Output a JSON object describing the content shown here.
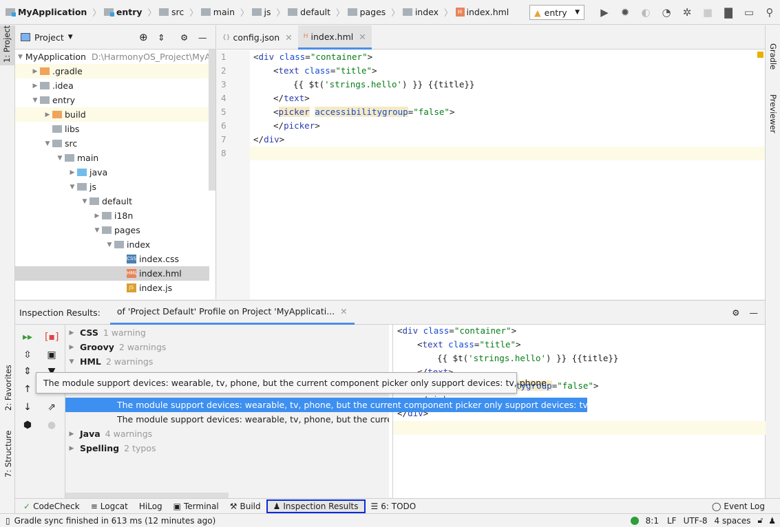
{
  "breadcrumb": [
    "MyApplication",
    "entry",
    "src",
    "main",
    "js",
    "default",
    "pages",
    "index",
    "index.hml"
  ],
  "toolbar": {
    "run_config": "entry",
    "icons": [
      "run-icon",
      "debug-icon",
      "attach-icon",
      "profile-icon",
      "build-icon",
      "stop-icon",
      "project-structure-icon",
      "device-icon",
      "search-icon"
    ]
  },
  "left_stripe": {
    "project": "1: Project",
    "favorites": "2: Favorites",
    "structure": "7: Structure"
  },
  "right_stripe": {
    "gradle": "Gradle",
    "previewer": "Previewer"
  },
  "project_panel": {
    "title": "Project",
    "tree": [
      {
        "label": "MyApplication",
        "path": "D:\\HarmonyOS_Project\\MyA",
        "level": 0,
        "arrow": "down",
        "icon": "module"
      },
      {
        "label": ".gradle",
        "level": 1,
        "arrow": "right",
        "icon": "orange",
        "hl": true
      },
      {
        "label": ".idea",
        "level": 1,
        "arrow": "right",
        "icon": "gray"
      },
      {
        "label": "entry",
        "level": 1,
        "arrow": "down",
        "icon": "module"
      },
      {
        "label": "build",
        "level": 2,
        "arrow": "right",
        "icon": "orange",
        "hl": true
      },
      {
        "label": "libs",
        "level": 2,
        "arrow": "",
        "icon": "gray"
      },
      {
        "label": "src",
        "level": 2,
        "arrow": "down",
        "icon": "gray"
      },
      {
        "label": "main",
        "level": 3,
        "arrow": "down",
        "icon": "gray"
      },
      {
        "label": "java",
        "level": 4,
        "arrow": "right",
        "icon": "blue"
      },
      {
        "label": "js",
        "level": 4,
        "arrow": "down",
        "icon": "gray"
      },
      {
        "label": "default",
        "level": 5,
        "arrow": "down",
        "icon": "gray"
      },
      {
        "label": "i18n",
        "level": 6,
        "arrow": "right",
        "icon": "gray"
      },
      {
        "label": "pages",
        "level": 6,
        "arrow": "down",
        "icon": "gray"
      },
      {
        "label": "index",
        "level": 7,
        "arrow": "down",
        "icon": "gray"
      },
      {
        "label": "index.css",
        "level": 8,
        "arrow": "",
        "icon": "css"
      },
      {
        "label": "index.hml",
        "level": 8,
        "arrow": "",
        "icon": "hml",
        "selected": true
      },
      {
        "label": "index.js",
        "level": 8,
        "arrow": "",
        "icon": "js"
      }
    ]
  },
  "editor": {
    "tabs": [
      {
        "label": "config.json",
        "active": false
      },
      {
        "label": "index.hml",
        "active": true
      }
    ],
    "lines": [
      "1",
      "2",
      "3",
      "4",
      "5",
      "6",
      "7",
      "8"
    ]
  },
  "inspection": {
    "title": "Inspection Results:",
    "tab": "of 'Project Default' Profile on Project 'MyApplicati...",
    "groups": [
      {
        "name": "CSS",
        "count": "1 warning"
      },
      {
        "name": "Groovy",
        "count": "2 warnings"
      },
      {
        "name": "HML",
        "count": "2 warnings"
      },
      {
        "name": "Java",
        "count": "4 warnings"
      },
      {
        "name": "Spelling",
        "count": "2 typos"
      }
    ],
    "selected_item": "The module support devices: wearable, tv, phone, but the current component picker only support devices: tv, phone.",
    "second_item": "The module support devices: wearable, tv, phone, but the current at",
    "tooltip": "The module support devices: wearable, tv, phone, but the current component picker only support devices: tv, phone."
  },
  "tool_windows": [
    "CodeCheck",
    "Logcat",
    "HiLog",
    "Terminal",
    "Build",
    "Inspection Results",
    "6: TODO"
  ],
  "event_log": "Event Log",
  "status": {
    "message": "Gradle sync finished in 613 ms (12 minutes ago)",
    "position": "8:1",
    "line_sep": "LF",
    "encoding": "UTF-8",
    "indent": "4 spaces"
  },
  "colors": {
    "accent": "#3d8ff0",
    "selection_outline": "#0a2bd6",
    "highlight_row": "#fdfbe6"
  }
}
